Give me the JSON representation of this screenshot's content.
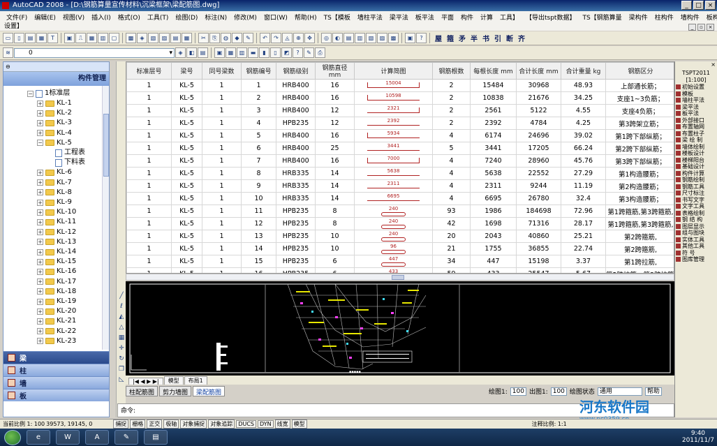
{
  "window": {
    "title": "AutoCAD 2008 - [D:\\钢筋算量宣传材料\\沉梁框架\\梁配筋图.dwg]",
    "buttons": [
      "_",
      "□",
      "×"
    ]
  },
  "menu": [
    "文件(F)",
    "编辑(E)",
    "视图(V)",
    "插入(I)",
    "格式(O)",
    "工具(T)",
    "绘图(D)",
    "标注(N)",
    "修改(M)",
    "窗口(W)",
    "帮助(H)",
    "TS【模板",
    "墙柱平法",
    "梁平法",
    "板平法",
    "平面",
    "构件",
    "计算",
    "工具】",
    "【导出tspt数据】",
    "TS【钢筋算量",
    "梁构件",
    "柱构件",
    "墙构件",
    "板构件"
  ],
  "menu_line2": "设置】",
  "toolbar2": {
    "layer_value": "0",
    "text_icons": [
      "屋",
      "箍",
      "矛",
      "半",
      "书",
      "引",
      "断",
      "齐"
    ]
  },
  "left_panel": {
    "title": "构件管理",
    "root": "1标准层",
    "nodes": [
      "KL-1",
      "KL-2",
      "KL-3",
      "KL-4",
      "KL-5",
      "KL-6",
      "KL-7",
      "KL-8",
      "KL-9",
      "KL-10",
      "KL-11",
      "KL-12",
      "KL-13",
      "KL-14",
      "KL-15",
      "KL-16",
      "KL-17",
      "KL-18",
      "KL-19",
      "KL-20",
      "KL-21",
      "KL-22",
      "KL-23"
    ],
    "children": [
      "工程表",
      "下料表"
    ],
    "modules": [
      "梁",
      "柱",
      "墙",
      "板"
    ]
  },
  "table": {
    "headers": [
      "标准层号",
      "梁号",
      "同号梁数",
      "钢筋编号",
      "钢筋级别",
      "钢筋直径 mm",
      "计算简图",
      "钢筋根数",
      "每根长度 mm",
      "合计长度 mm",
      "合计重量 kg",
      "钢筋区分"
    ],
    "rows": [
      [
        "1",
        "KL-5",
        "1",
        "1",
        "HRB400",
        "16",
        "15004",
        "2",
        "15484",
        "30968",
        "48.93",
        "上部通长筋；"
      ],
      [
        "1",
        "KL-5",
        "1",
        "2",
        "HRB400",
        "16",
        "10598",
        "2",
        "10838",
        "21676",
        "34.25",
        "支座1~3负筋；"
      ],
      [
        "1",
        "KL-5",
        "1",
        "3",
        "HRB400",
        "12",
        "2321",
        "2",
        "2561",
        "5122",
        "4.55",
        "支座4负筋；"
      ],
      [
        "1",
        "KL-5",
        "1",
        "4",
        "HPB235",
        "12",
        "2392",
        "2",
        "2392",
        "4784",
        "4.25",
        "第3跨架立筋；"
      ],
      [
        "1",
        "KL-5",
        "1",
        "5",
        "HRB400",
        "16",
        "5934",
        "4",
        "6174",
        "24696",
        "39.02",
        "第1跨下部纵筋；"
      ],
      [
        "1",
        "KL-5",
        "1",
        "6",
        "HRB400",
        "25",
        "3441",
        "5",
        "3441",
        "17205",
        "66.24",
        "第2跨下部纵筋；"
      ],
      [
        "1",
        "KL-5",
        "1",
        "7",
        "HRB400",
        "16",
        "7000",
        "4",
        "7240",
        "28960",
        "45.76",
        "第3跨下部纵筋；"
      ],
      [
        "1",
        "KL-5",
        "1",
        "8",
        "HRB335",
        "14",
        "5638",
        "4",
        "5638",
        "22552",
        "27.29",
        "第1构造腰筋；"
      ],
      [
        "1",
        "KL-5",
        "1",
        "9",
        "HRB335",
        "14",
        "2311",
        "4",
        "2311",
        "9244",
        "11.19",
        "第2构造腰筋；"
      ],
      [
        "1",
        "KL-5",
        "1",
        "10",
        "HRB335",
        "14",
        "6695",
        "4",
        "6695",
        "26780",
        "32.4",
        "第3构造腰筋；"
      ],
      [
        "1",
        "KL-5",
        "1",
        "11",
        "HPB235",
        "8",
        "240",
        "93",
        "1986",
        "184698",
        "72.96",
        "第1跨箍筋,第3跨箍筋,"
      ],
      [
        "1",
        "KL-5",
        "1",
        "12",
        "HPB235",
        "8",
        "240",
        "42",
        "1698",
        "71316",
        "28.17",
        "第1跨箍筋,第3跨箍筋,"
      ],
      [
        "1",
        "KL-5",
        "1",
        "13",
        "HPB235",
        "10",
        "240",
        "20",
        "2043",
        "40860",
        "25.21",
        "第2跨箍筋,"
      ],
      [
        "1",
        "KL-5",
        "1",
        "14",
        "HPB235",
        "10",
        "96",
        "21",
        "1755",
        "36855",
        "22.74",
        "第2跨箍筋,"
      ],
      [
        "1",
        "KL-5",
        "1",
        "15",
        "HPB235",
        "6",
        "447",
        "34",
        "447",
        "15198",
        "3.37",
        "第1跨拉筋,"
      ],
      [
        "1",
        "KL-5",
        "1",
        "16",
        "HPB235",
        "6",
        "433",
        "59",
        "433",
        "25547",
        "5.67",
        "第2跨拉筋，第3跨拉筋,"
      ]
    ]
  },
  "layout_tabs": [
    "模型",
    "布局1"
  ],
  "doc_tabs": [
    "柱配筋图",
    "剪力墙图",
    "梁配筋图"
  ],
  "scale": {
    "label1": "绘图1:",
    "v1": "100",
    "label2": "出图1:",
    "v2": "100",
    "label3": "绘图状态",
    "v3": "通用",
    "help": "帮助"
  },
  "command": "命令:",
  "right_panel": {
    "title": "TSPT2011",
    "scale": "[1:100]",
    "items": [
      "初始设置",
      "模板",
      "墙柱平法",
      "梁平法",
      "板平法",
      "外部接口",
      "布置轴网",
      "布置柱子",
      "梁 绘 制",
      "墙体绘制",
      "楼板设计",
      "楼梯阳台",
      "基础设计",
      "构件计算",
      "钢筋绘制",
      "钢筋工具",
      "尺寸标注",
      "书写文字",
      "文字工具",
      "表格绘制",
      "钢 结 构",
      "图层显示",
      "组与图块",
      "实体工具",
      "其他工具",
      "符 号",
      "图库管理"
    ]
  },
  "status": {
    "scale_text": "当前比例 1: 100",
    "coords": "39573,   19145,  0",
    "toggles": [
      "捕捉",
      "栅格",
      "正交",
      "极轴",
      "对象捕捉",
      "对象追踪",
      "DUCS",
      "DYN",
      "线宽",
      "模型"
    ],
    "annotation": "注释比例: 1:1"
  },
  "taskbar": {
    "time": "9:40",
    "date": "2011/11/7"
  },
  "watermark": {
    "main": "河东软件园",
    "sub": "www.pc0359.cn"
  }
}
